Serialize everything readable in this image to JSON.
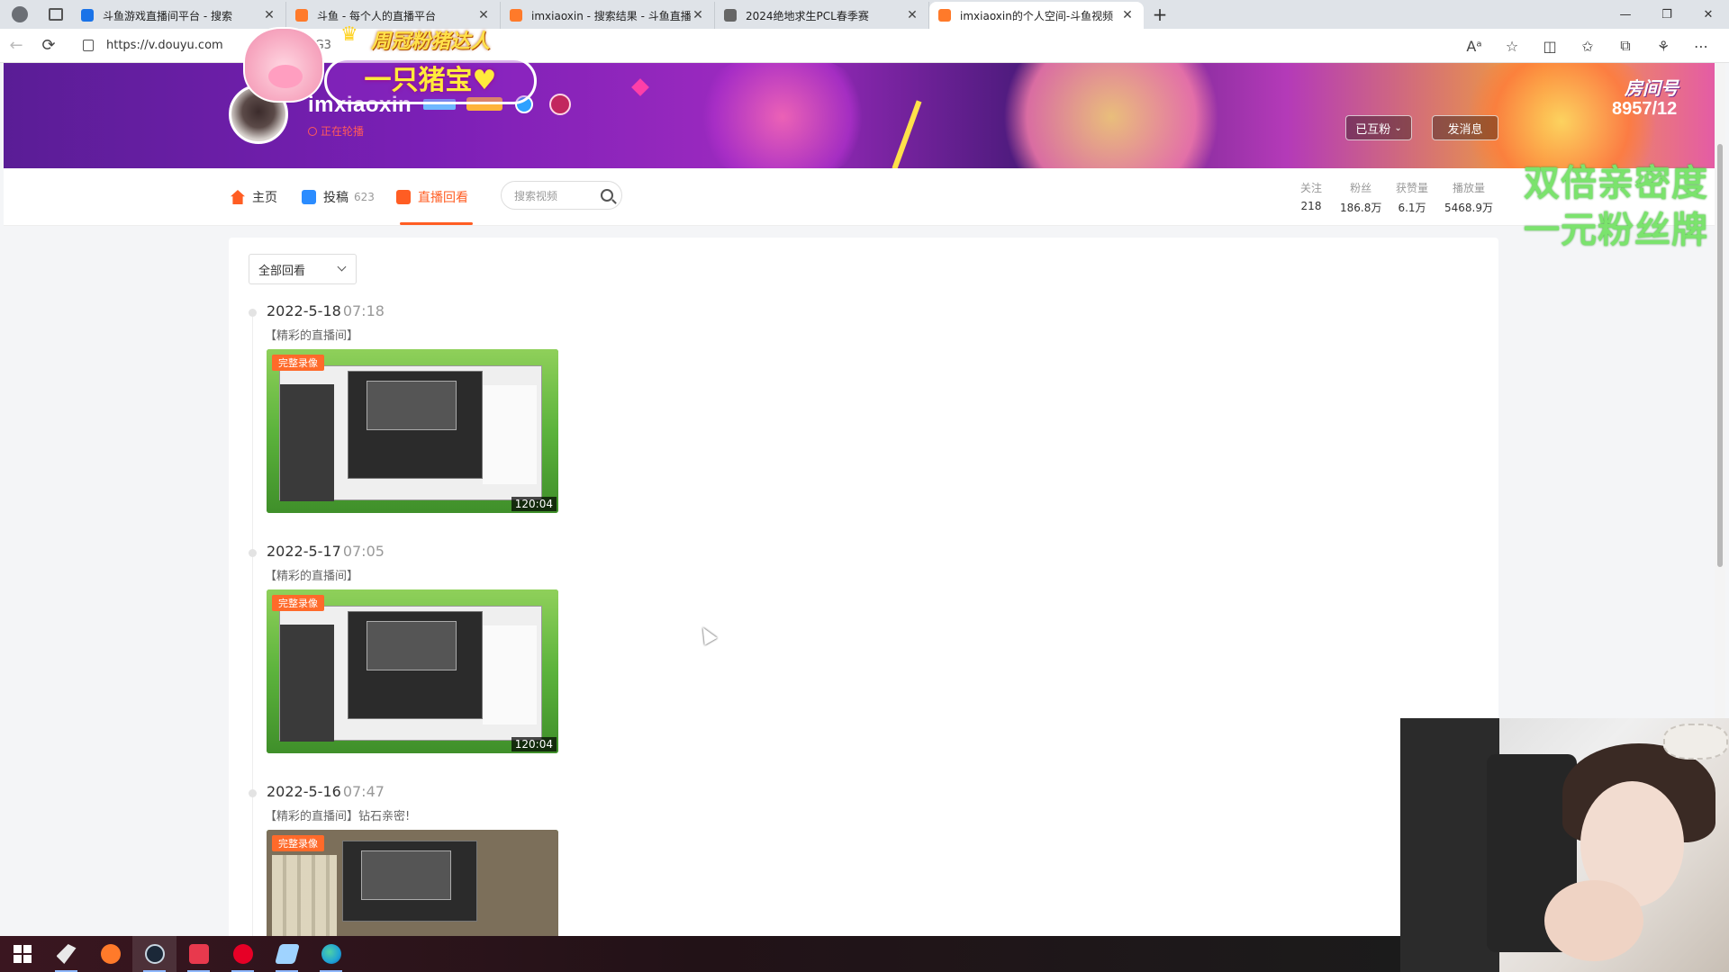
{
  "browser": {
    "tabs": [
      {
        "title": "斗鱼游戏直播间平台 - 搜索",
        "favicon_color": "#1a73e8",
        "active": false
      },
      {
        "title": "斗鱼 - 每个人的直播平台",
        "favicon_color": "#ff7a2a",
        "active": false
      },
      {
        "title": "imxiaoxin - 搜索结果 - 斗鱼直播",
        "favicon_color": "#ff7a2a",
        "active": false
      },
      {
        "title": "2024绝地求生PCL春季赛",
        "favicon_color": "#666666",
        "active": false
      },
      {
        "title": "imxiaoxin的个人空间-斗鱼视频",
        "favicon_color": "#ff7a2a",
        "active": true
      }
    ],
    "new_tab_label": "+",
    "window_controls": {
      "minimize": "—",
      "restore": "❐",
      "close": "✕"
    },
    "url": "https://v.douyu.com",
    "url_suffix": "5lG3",
    "nav": {
      "back": "←",
      "reload": "⟳"
    }
  },
  "banner": {
    "username": "imxiaoxin",
    "live_status": "正在轮播",
    "sticker_top": "周冠粉猪达人",
    "sticker_title": "一只猪宝♥",
    "room_label": "房间号",
    "room_number": "8957/12",
    "follow_button": "已互粉",
    "message_button": "发消息"
  },
  "subnav": {
    "items": [
      {
        "label": "主页",
        "count": "",
        "icon": "home-icon",
        "color": "#ff5d23"
      },
      {
        "label": "投稿",
        "count": "623",
        "icon": "upload-icon",
        "color": "#2b8cff"
      },
      {
        "label": "直播回看",
        "count": "",
        "icon": "replay-icon",
        "color": "#ff5d23"
      }
    ],
    "search_placeholder": "搜索视频",
    "stats": [
      {
        "label": "关注",
        "value": "218"
      },
      {
        "label": "粉丝",
        "value": "186.8万"
      },
      {
        "label": "获赞量",
        "value": "6.1万"
      },
      {
        "label": "播放量",
        "value": "5468.9万"
      }
    ]
  },
  "promo": {
    "line1": "双倍亲密度",
    "line2": "一元粉丝牌"
  },
  "content": {
    "filter_label": "全部回看",
    "entries": [
      {
        "date": "2022-5-18",
        "time": "07:18",
        "title": "【精彩的直播间】",
        "badge": "完整录像",
        "duration": "120:04",
        "style": "green"
      },
      {
        "date": "2022-5-17",
        "time": "07:05",
        "title": "【精彩的直播间】",
        "badge": "完整录像",
        "duration": "120:04",
        "style": "green"
      },
      {
        "date": "2022-5-16",
        "time": "07:47",
        "title": "【精彩的直播间】钻石亲密!",
        "badge": "完整录像",
        "duration": "",
        "style": "brown"
      }
    ]
  },
  "taskbar": {
    "apps": [
      {
        "name": "start-button",
        "color": "#ffffff"
      },
      {
        "name": "app-pin-1",
        "color": "#e8e8e8"
      },
      {
        "name": "app-pin-2",
        "color": "#ff7a2a"
      },
      {
        "name": "steam-app",
        "color": "#1b2838"
      },
      {
        "name": "app-pin-4",
        "color": "#e8394d"
      },
      {
        "name": "netease-music-app",
        "color": "#e60026"
      },
      {
        "name": "app-pin-6",
        "color": "#9fd3ff"
      },
      {
        "name": "edge-browser-app",
        "color": "#1fa2d6"
      }
    ]
  }
}
